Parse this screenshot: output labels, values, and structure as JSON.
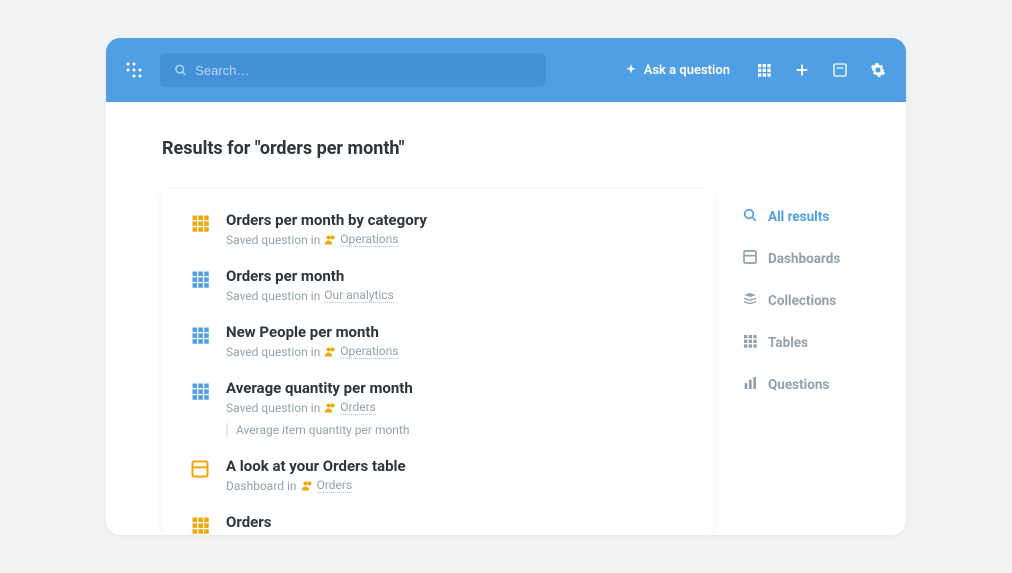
{
  "header": {
    "search_placeholder": "Search…",
    "ask_label": "Ask a question"
  },
  "page": {
    "title": "Results for \"orders per month\""
  },
  "results": [
    {
      "icon": "table",
      "icon_color": "#f2a60d",
      "title": "Orders per month by category",
      "meta_prefix": "Saved question in",
      "verified": true,
      "location": "Operations"
    },
    {
      "icon": "table",
      "icon_color": "#509ee3",
      "title": "Orders per month",
      "meta_prefix": "Saved question in",
      "verified": false,
      "location": "Our analytics"
    },
    {
      "icon": "table",
      "icon_color": "#509ee3",
      "title": "New People per month",
      "meta_prefix": "Saved question in",
      "verified": true,
      "location": "Operations"
    },
    {
      "icon": "table",
      "icon_color": "#509ee3",
      "title": "Average quantity per month",
      "meta_prefix": "Saved question in",
      "verified": true,
      "location": "Orders",
      "description": "Average item quantity per month"
    },
    {
      "icon": "dashboard",
      "icon_color": "#f2a60d",
      "title": "A look at your Orders table",
      "meta_prefix": "Dashboard in",
      "verified": true,
      "location": "Orders"
    },
    {
      "icon": "table",
      "icon_color": "#f2a60d",
      "title": "Orders"
    }
  ],
  "filters": [
    {
      "icon": "search",
      "label": "All results",
      "active": true
    },
    {
      "icon": "dashboard",
      "label": "Dashboards",
      "active": false
    },
    {
      "icon": "collections",
      "label": "Collections",
      "active": false
    },
    {
      "icon": "tables",
      "label": "Tables",
      "active": false
    },
    {
      "icon": "questions",
      "label": "Questions",
      "active": false
    }
  ]
}
